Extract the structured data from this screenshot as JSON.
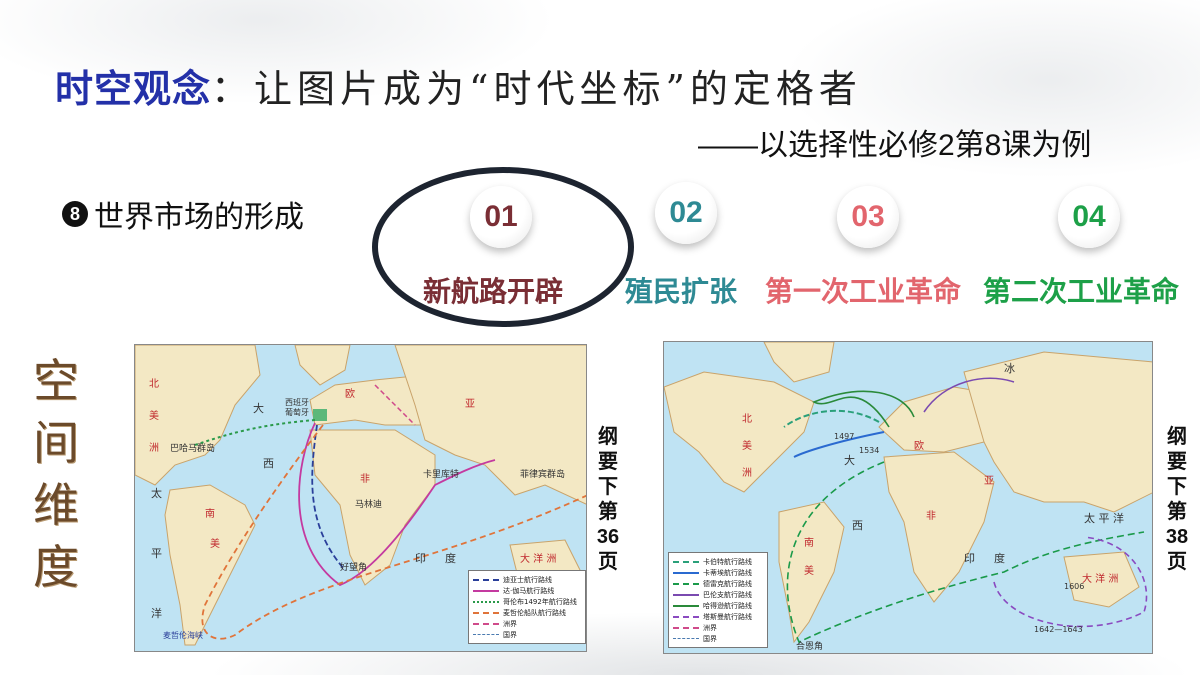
{
  "title": {
    "highlight": "时空观念",
    "rest": "：让图片成为“时代坐标”的定格者"
  },
  "subtitle": "——以选择性必修2第8课为例",
  "topic": {
    "number": "8",
    "text": "世界市场的形成"
  },
  "steps": [
    {
      "num": "01",
      "label": "新航路开辟",
      "color": "#7a2e35"
    },
    {
      "num": "02",
      "label": "殖民扩张",
      "color": "#2e8a94"
    },
    {
      "num": "03",
      "label": "第一次工业革命",
      "color": "#e2656d"
    },
    {
      "num": "04",
      "label": "第二次工业革命",
      "color": "#1da048"
    }
  ],
  "side_word": [
    "空",
    "间",
    "维",
    "度"
  ],
  "map_left": {
    "note": [
      "纲",
      "要",
      "下",
      "第",
      "36",
      "页"
    ],
    "labels": {
      "bei": "北",
      "mei": "美",
      "zhou": "洲",
      "tai": "太",
      "ping": "平",
      "yang": "洋",
      "ou": "欧",
      "ya": "亚",
      "fei": "非",
      "nan": "南",
      "nanmei": "美",
      "da": "大",
      "xi": "西",
      "yin": "印",
      "du": "度",
      "dayang": "大 洋 洲",
      "bahama": "巴哈马群岛",
      "spain": "西班牙",
      "portugal": "葡萄牙",
      "calicut": "卡里库特",
      "philippines": "菲律宾群岛",
      "malindi": "马林迪",
      "cape": "好望角",
      "magellan": "麦哲伦海峡"
    },
    "legend": [
      {
        "label": "迪亚士航行路线",
        "color": "#2a3f9a"
      },
      {
        "label": "达·伽马航行路线",
        "color": "#c43aa0"
      },
      {
        "label": "哥伦布1492年航行路线",
        "color": "#2a9a4a"
      },
      {
        "label": "麦哲伦船队航行路线",
        "color": "#e0743a"
      },
      {
        "label": "洲界",
        "color": "#d04a8a"
      },
      {
        "label": "国界",
        "color": "#4a7ab0"
      }
    ]
  },
  "map_right": {
    "note": [
      "纲",
      "要",
      "下",
      "第",
      "38",
      "页"
    ],
    "labels": {
      "bei": "北",
      "mei": "美",
      "zhou": "洲",
      "ou": "欧",
      "ya": "亚",
      "fei": "非",
      "nan": "南",
      "nanmei": "美",
      "da": "大",
      "xi": "西",
      "yin": "印",
      "du": "度",
      "taiping": "太 平 洋",
      "bing": "冰",
      "dayang": "大 洋 洲",
      "cape_horn": "合恩角",
      "y1497": "1497",
      "y1534": "1534",
      "y1606": "1606",
      "y1642": "1642—1643"
    },
    "legend": [
      {
        "label": "卡伯特航行路线",
        "color": "#2aa07a"
      },
      {
        "label": "卡蒂埃航行路线",
        "color": "#2a6ad0"
      },
      {
        "label": "德雷克航行路线",
        "color": "#1a9a4a"
      },
      {
        "label": "巴伦支航行路线",
        "color": "#7a4ab0"
      },
      {
        "label": "哈得逊航行路线",
        "color": "#2a8a3a"
      },
      {
        "label": "塔斯曼航行路线",
        "color": "#8a4ac0"
      },
      {
        "label": "洲界",
        "color": "#d04a8a"
      },
      {
        "label": "国界",
        "color": "#4a7ab0"
      }
    ]
  }
}
